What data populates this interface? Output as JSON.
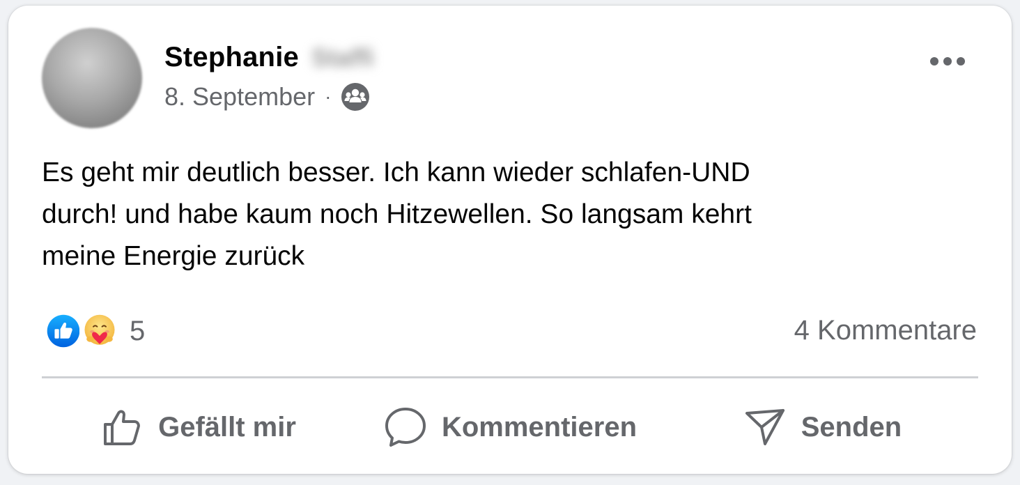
{
  "post": {
    "author_first_name": "Stephanie",
    "author_last_name_blurred": "Staffi",
    "date": "8. September",
    "separator": "·",
    "audience_icon": "group-icon",
    "body": "Es geht mir deutlich besser. Ich kann wieder schlafen-UND\ndurch! und habe kaum noch Hitzewellen. So langsam kehrt\nmeine Energie zurück"
  },
  "reactions": {
    "types": [
      "like-icon",
      "care-icon"
    ],
    "count": "5"
  },
  "comments": {
    "label": "4 Kommentare"
  },
  "actions": {
    "like_label": "Gefällt mir",
    "comment_label": "Kommentieren",
    "share_label": "Senden"
  },
  "colors": {
    "like_blue": "#1877f2",
    "secondary_text": "#65676b",
    "divider": "#ced0d4"
  }
}
